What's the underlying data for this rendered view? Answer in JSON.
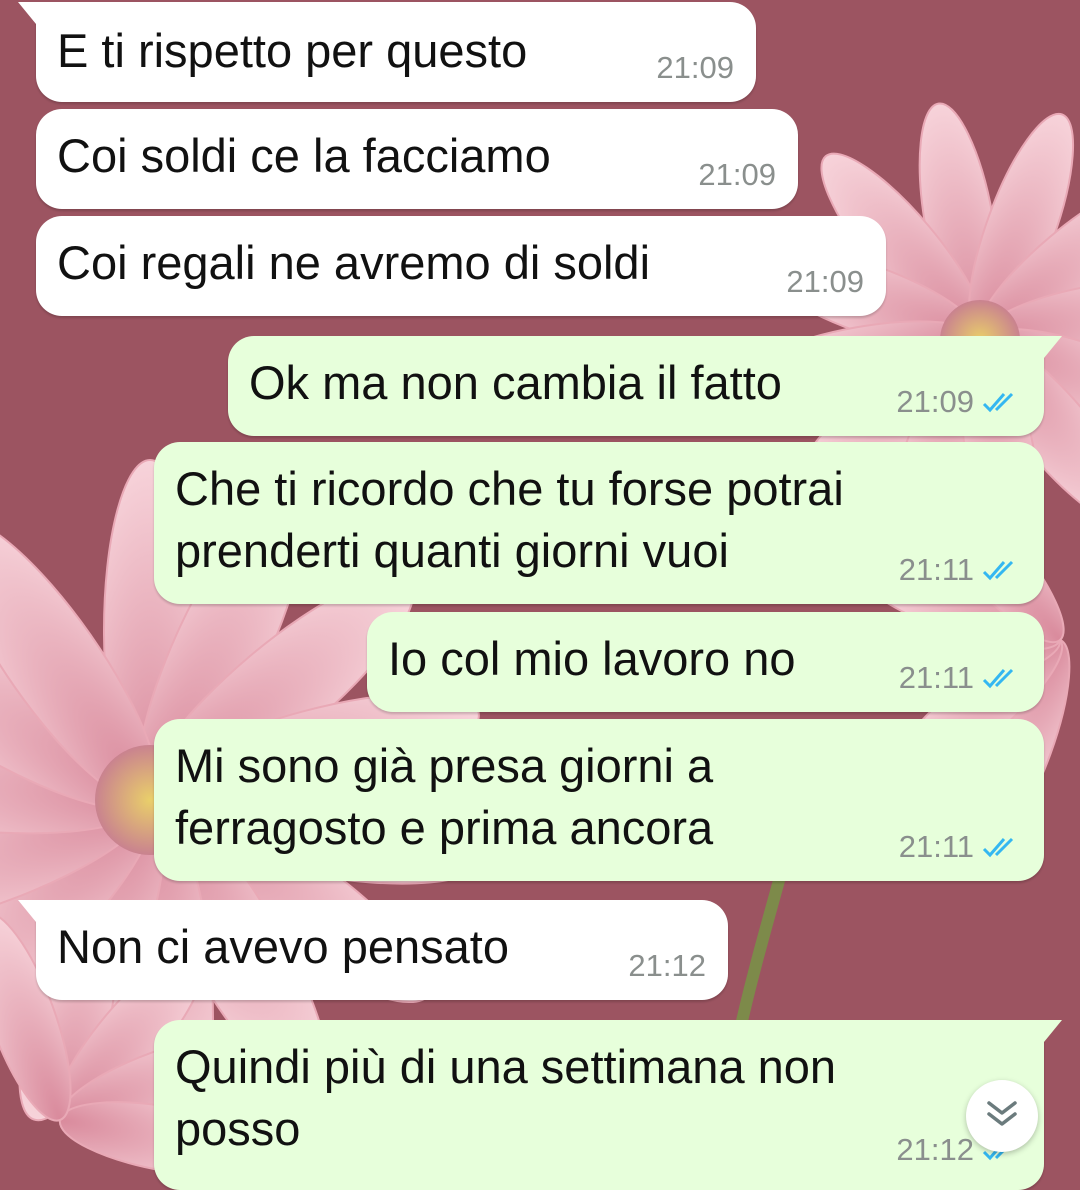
{
  "colors": {
    "incoming_bubble": "#ffffff",
    "outgoing_bubble": "#e7ffdb",
    "time_text": "#8a8f8d",
    "read_ticks": "#34b7f1",
    "wallpaper": "#9c5461"
  },
  "messages": [
    {
      "direction": "incoming",
      "text": "E ti rispetto per questo",
      "time": "21:09"
    },
    {
      "direction": "incoming",
      "text": "Coi soldi ce la facciamo",
      "time": "21:09"
    },
    {
      "direction": "incoming",
      "text": "Coi regali ne avremo di soldi",
      "time": "21:09"
    },
    {
      "direction": "outgoing",
      "text": "Ok ma non cambia il fatto",
      "time": "21:09",
      "status": "read"
    },
    {
      "direction": "outgoing",
      "text_lines": [
        "Che ti ricordo che tu forse potrai",
        "prenderti quanti giorni vuoi"
      ],
      "time": "21:11",
      "status": "read"
    },
    {
      "direction": "outgoing",
      "text": "Io col mio lavoro no",
      "time": "21:11",
      "status": "read"
    },
    {
      "direction": "outgoing",
      "text_lines": [
        "Mi sono già presa giorni a",
        "ferragosto e prima ancora"
      ],
      "time": "21:11",
      "status": "read"
    },
    {
      "direction": "incoming",
      "text": "Non ci avevo pensato",
      "time": "21:12"
    },
    {
      "direction": "outgoing",
      "text_lines": [
        "Quindi più di una settimana non",
        "posso"
      ],
      "time": "21:12",
      "status": "read"
    }
  ],
  "scroll_button": {
    "icon": "double-chevron-down-icon"
  }
}
